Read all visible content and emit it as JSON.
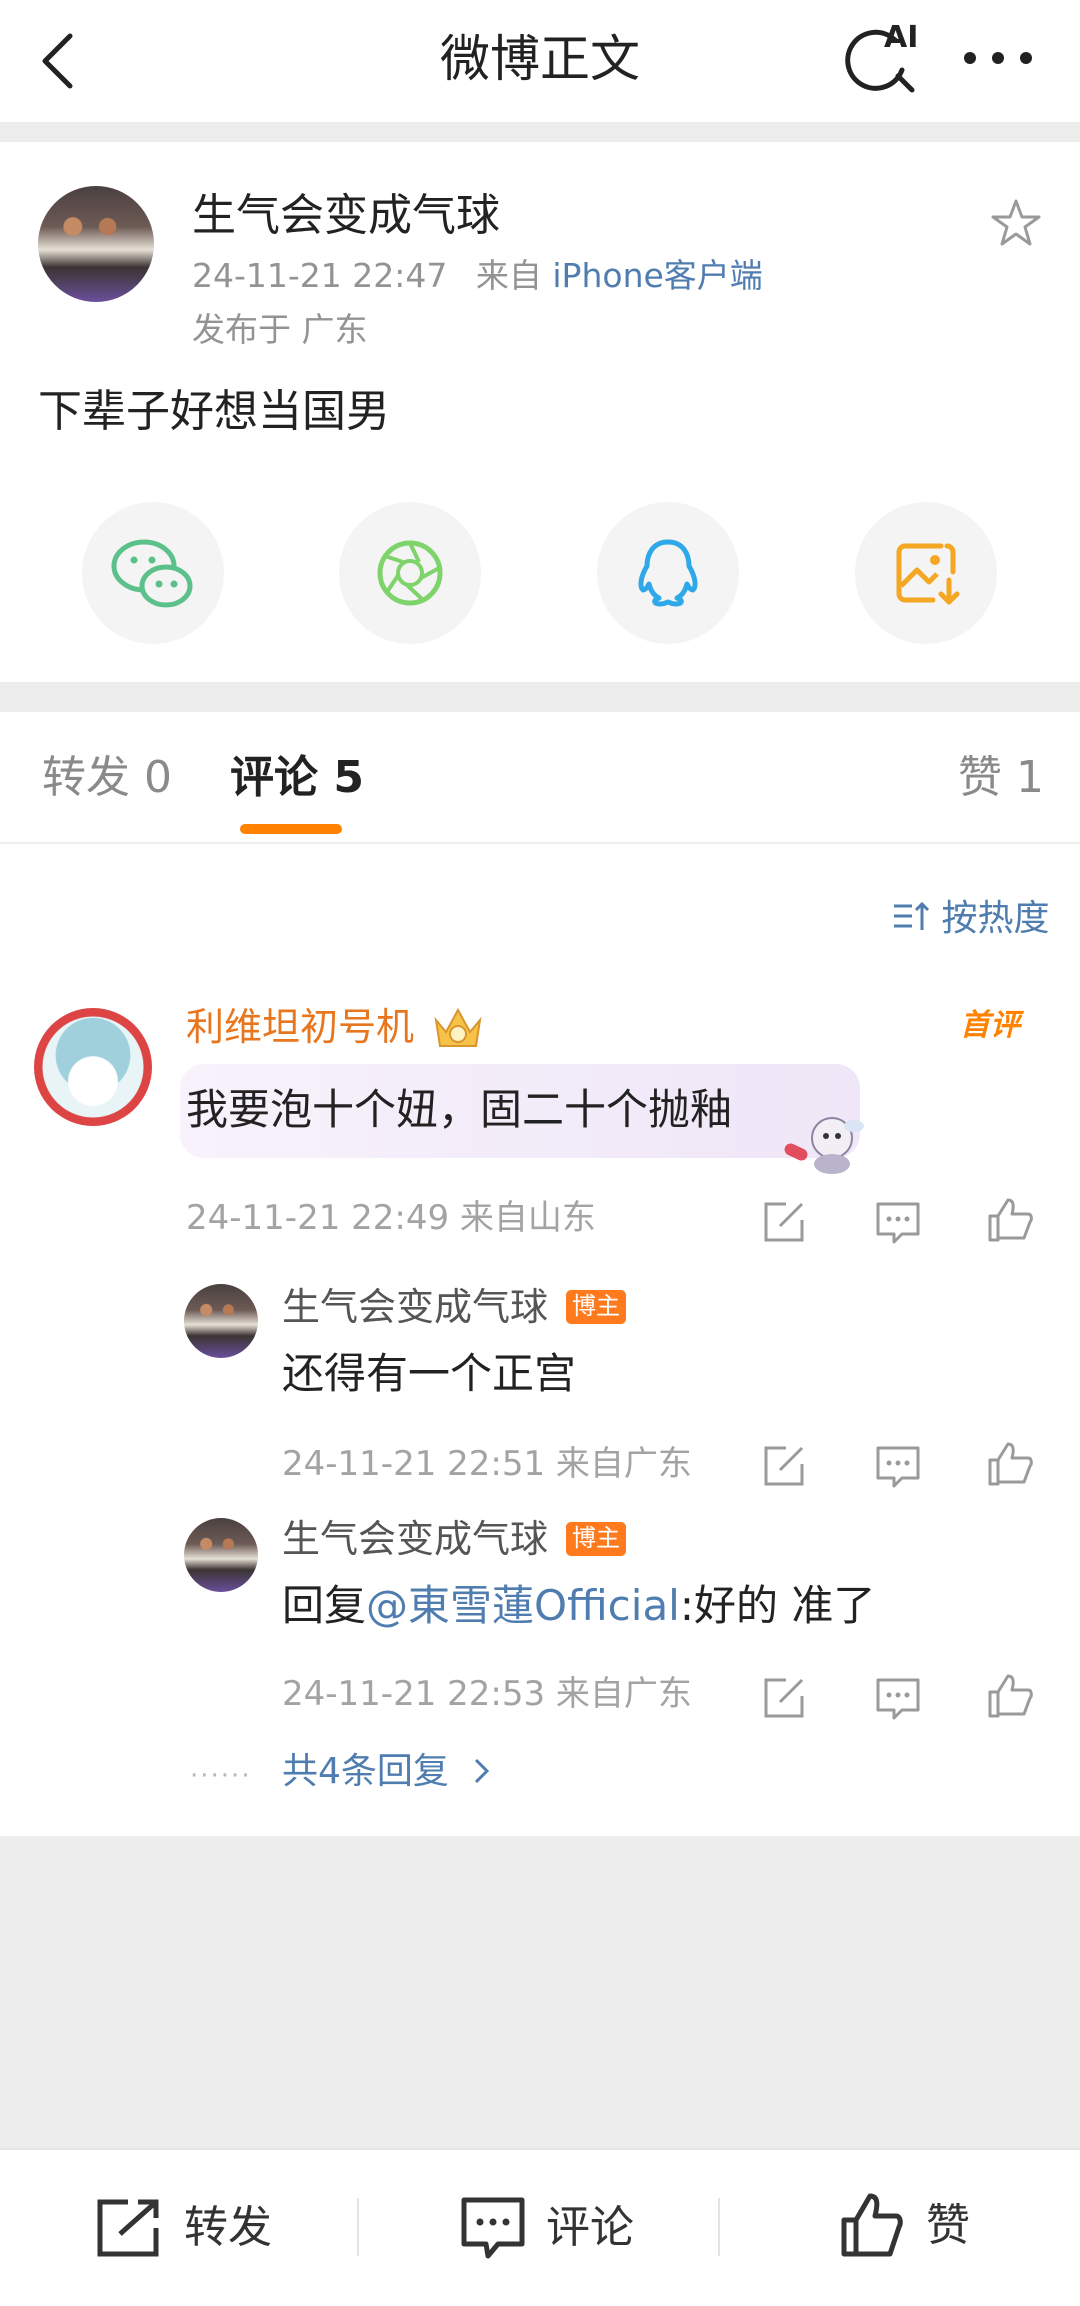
{
  "header": {
    "title": "微博正文",
    "ai_label": "AI"
  },
  "post": {
    "author": "生气会变成气球",
    "time": "24-11-21 22:47",
    "source_prefix": "来自",
    "source": "iPhone客户端",
    "location": "发布于 广东",
    "text": "下辈子好想当国男"
  },
  "share_icons": [
    "wechat-icon",
    "moments-icon",
    "qq-icon",
    "save-image-icon"
  ],
  "colors": {
    "accent_orange": "#ff8200",
    "link_blue": "#507daf",
    "wechat_green": "#5bc08a",
    "moments_green": "#7ed36a",
    "qq_blue": "#2ea8e8",
    "save_orange": "#f5a623"
  },
  "tabs": {
    "repost": "转发 0",
    "comment": "评论 5",
    "like": "赞 1"
  },
  "comments": {
    "sort_label": "按热度",
    "first_comment_badge": "首评",
    "main": {
      "author": "利维坦初号机",
      "text": "我要泡十个妞，固二十个抛釉",
      "meta": "24-11-21 22:49 来自山东"
    },
    "replies": [
      {
        "author": "生气会变成气球",
        "badge": "博主",
        "text": "还得有一个正宫",
        "meta": "24-11-21 22:51 来自广东"
      },
      {
        "author": "生气会变成气球",
        "badge": "博主",
        "text_prefix": "回复",
        "mention": "@東雪蓮Official",
        "text_suffix": ":好的 准了",
        "meta": "24-11-21 22:53 来自广东"
      }
    ],
    "more_dots": "······",
    "more_replies": "共4条回复"
  },
  "bottom_bar": {
    "repost": "转发",
    "comment": "评论",
    "like": "赞"
  }
}
